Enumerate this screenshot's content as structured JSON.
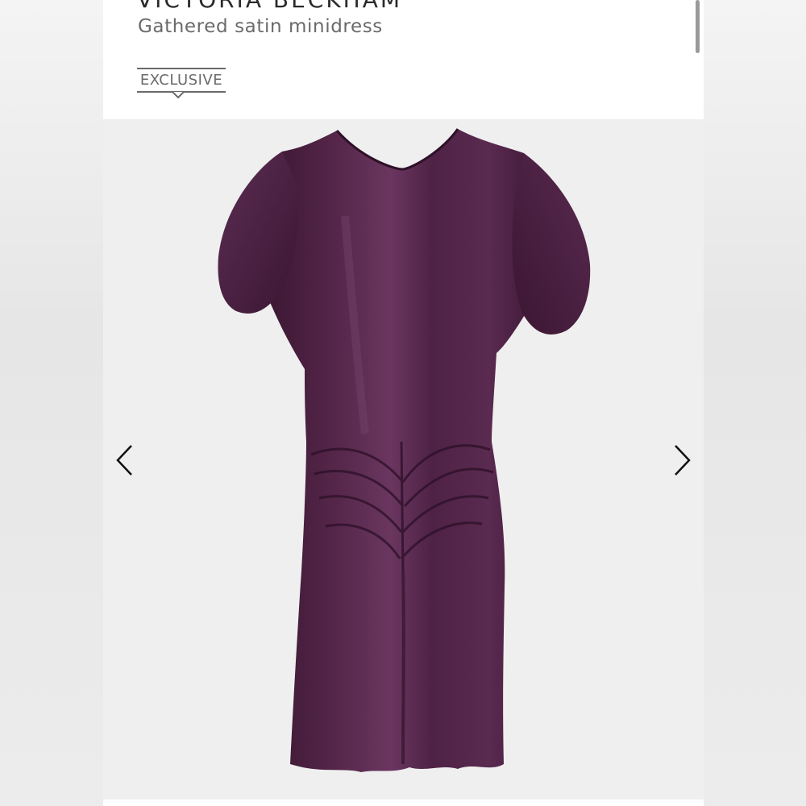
{
  "product": {
    "brand": "VICTORIA BECKHAM",
    "name": "Gathered satin minidress",
    "badge": "EXCLUSIVE"
  },
  "gallery": {
    "image_alt": "Purple gathered satin minidress",
    "prev_icon": "chevron-left-icon",
    "next_icon": "chevron-right-icon"
  },
  "colors": {
    "dress": "#4a2140",
    "background": "#efefef",
    "text": "#6a6a6a"
  }
}
